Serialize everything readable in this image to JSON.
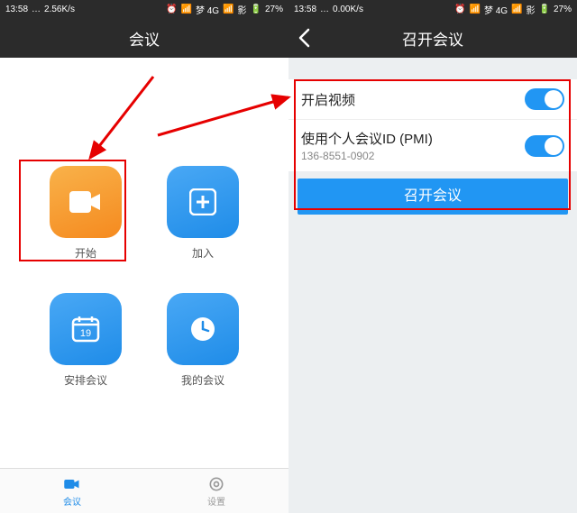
{
  "status_bar": {
    "time": "13:58",
    "net_speed_left": "2.56K/s",
    "net_speed_right": "0.00K/s",
    "carrier1": "梦 4G",
    "carrier2": "影",
    "battery": "27%"
  },
  "left_screen": {
    "title": "会议",
    "tiles": {
      "start": "开始",
      "join": "加入",
      "schedule": "安排会议",
      "mine": "我的会议",
      "schedule_day": "19"
    },
    "tabs": {
      "meetings": "会议",
      "settings": "设置"
    }
  },
  "right_screen": {
    "title": "召开会议",
    "video_label": "开启视频",
    "pmi_label": "使用个人会议ID (PMI)",
    "pmi_value": "136-8551-0902",
    "start_button": "召开会议"
  }
}
